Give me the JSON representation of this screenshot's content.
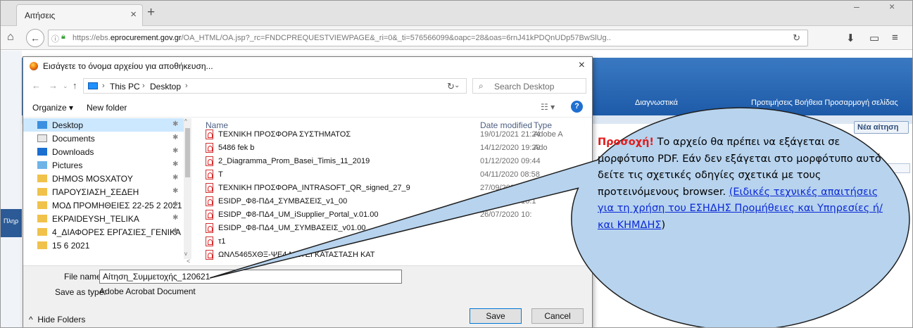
{
  "browser": {
    "tab_title": "Αιτήσεις",
    "tab_close": "×",
    "new_tab": "+",
    "url_prefix": "https://ebs.",
    "url_host": "eprocurement.gov.gr",
    "url_rest": "/OA_HTML/OA.jsp?_rc=FNDCPREQUESTVIEWPAGE&_ri=0&_ti=576566099&oapc=28&oas=6rnJ41kPDQnUDp57BwSlUg..",
    "icons": [
      "home-icon",
      "back-icon",
      "info-icon",
      "lock-icon",
      "reload-icon",
      "download-icon",
      "sidebar-icon",
      "menu-icon"
    ]
  },
  "page": {
    "menu_left": "Διαγνωστικά",
    "menu_right": "Προτιμήσεις  Βοήθεια  Προσαρμογή σελίδας",
    "new_request": "Νέα αίτηση"
  },
  "dialog": {
    "title": "Εισάγετε το όνομα αρχείου για αποθήκευση...",
    "close": "×",
    "breadcrumb": [
      "This PC",
      "Desktop"
    ],
    "search_placeholder": "Search Desktop",
    "organize": "Organize ▾",
    "new_folder": "New folder",
    "nav_items": [
      {
        "label": "Desktop",
        "icon": "desktop-folder-icon",
        "selected": true
      },
      {
        "label": "Documents",
        "icon": "documents-icon",
        "selected": false
      },
      {
        "label": "Downloads",
        "icon": "downloads-icon",
        "selected": false
      },
      {
        "label": "Pictures",
        "icon": "pictures-icon",
        "selected": false
      },
      {
        "label": "DHMOS MOSXATOY",
        "icon": "folder-icon",
        "selected": false
      },
      {
        "label": "ΠΑΡΟΥΣΙΑΣΗ_ΣΕΔΕΗ",
        "icon": "folder-icon",
        "selected": false
      },
      {
        "label": "ΜΟΔ ΠΡΟΜΗΘΕΙΕΣ 22-25 2 2021",
        "icon": "folder-icon",
        "selected": false
      },
      {
        "label": "EKPAIDEYSH_TELIKA",
        "icon": "folder-icon",
        "selected": false
      },
      {
        "label": "4_ΔΙΑΦΟΡΕΣ ΕΡΓΑΣΙΕΣ_ΓΕΝΙΚΑ",
        "icon": "folder-icon",
        "selected": false
      },
      {
        "label": "15 6 2021",
        "icon": "folder-icon",
        "selected": false
      }
    ],
    "columns": {
      "name": "Name",
      "date": "Date modified",
      "type": "Type"
    },
    "files": [
      {
        "name": "ΤΕΧΝΙΚΗ ΠΡΟΣΦΟΡΑ ΣΥΣΤΗΜΑΤΟΣ",
        "date": "19/01/2021 21:24",
        "type": "Adobe A"
      },
      {
        "name": "5486 fek b",
        "date": "14/12/2020 19:29",
        "type": "Ado"
      },
      {
        "name": "2_Diagramma_Prom_Basei_Timis_11_2019",
        "date": "01/12/2020 09:44",
        "type": ""
      },
      {
        "name": "T",
        "date": "04/11/2020 08:58",
        "type": ""
      },
      {
        "name": "ΤΕΧΝΙΚΗ ΠΡΟΣΦΟΡΑ_INTRASOFT_QR_signed_27_9",
        "date": "27/09/2020 18:22",
        "type": ""
      },
      {
        "name": "ESIDP_Φ8-ΠΔ4_ΣΥΜΒΑΣΕΙΣ_v1_00",
        "date": "26/07/2020 10:1",
        "type": ""
      },
      {
        "name": "ESIDP_Φ8-ΠΔ4_UM_iSupplier_Portal_v.01.00",
        "date": "26/07/2020 10:",
        "type": ""
      },
      {
        "name": "ESIDP_Φ8-ΠΔ4_UM_ΣΥΜΒΑΣΕΙΣ_v01.00",
        "date": "",
        "type": ""
      },
      {
        "name": "τ1",
        "date": "",
        "type": ""
      },
      {
        "name": "ΩΝΛ5465ΧΘΞ-ΨΕ4 ΜΕΤΕΓΚΑΤΑΣΤΑΣΗ ΚΑΤ",
        "date": "",
        "type": ""
      }
    ],
    "file_name_label": "File name:",
    "file_name_value": "Αίτηση_Συμμετοχής_120621",
    "save_as_type_label": "Save as type:",
    "save_as_type_value": "Adobe Acrobat Document",
    "hide_folders": "Hide Folders",
    "save_label": "Save",
    "cancel_label": "Cancel"
  },
  "callout": {
    "strong": "Προσοχή!",
    "text": " Το αρχείο θα πρέπει να εξάγεται σε μορφότυπο PDF. Εάν δεν εξάγεται στο μορφότυπο αυτό δείτε τις σχετικές οδηγίες σχετικά με τους προτεινόμενους browser. ",
    "link": "(Ειδικές τεχνικές απαιτήσεις για τη χρήση του ΕΣΗΔΗΣ Προμήθειες και Υπηρεσίες ή/και ΚΗΜΔΗΣ",
    "tail": ")",
    "colors": {
      "strong": "#e31b1b",
      "link": "#0b29d6",
      "bubble_fill": "#b7d3ee",
      "bubble_stroke": "#1e1e1e"
    }
  }
}
